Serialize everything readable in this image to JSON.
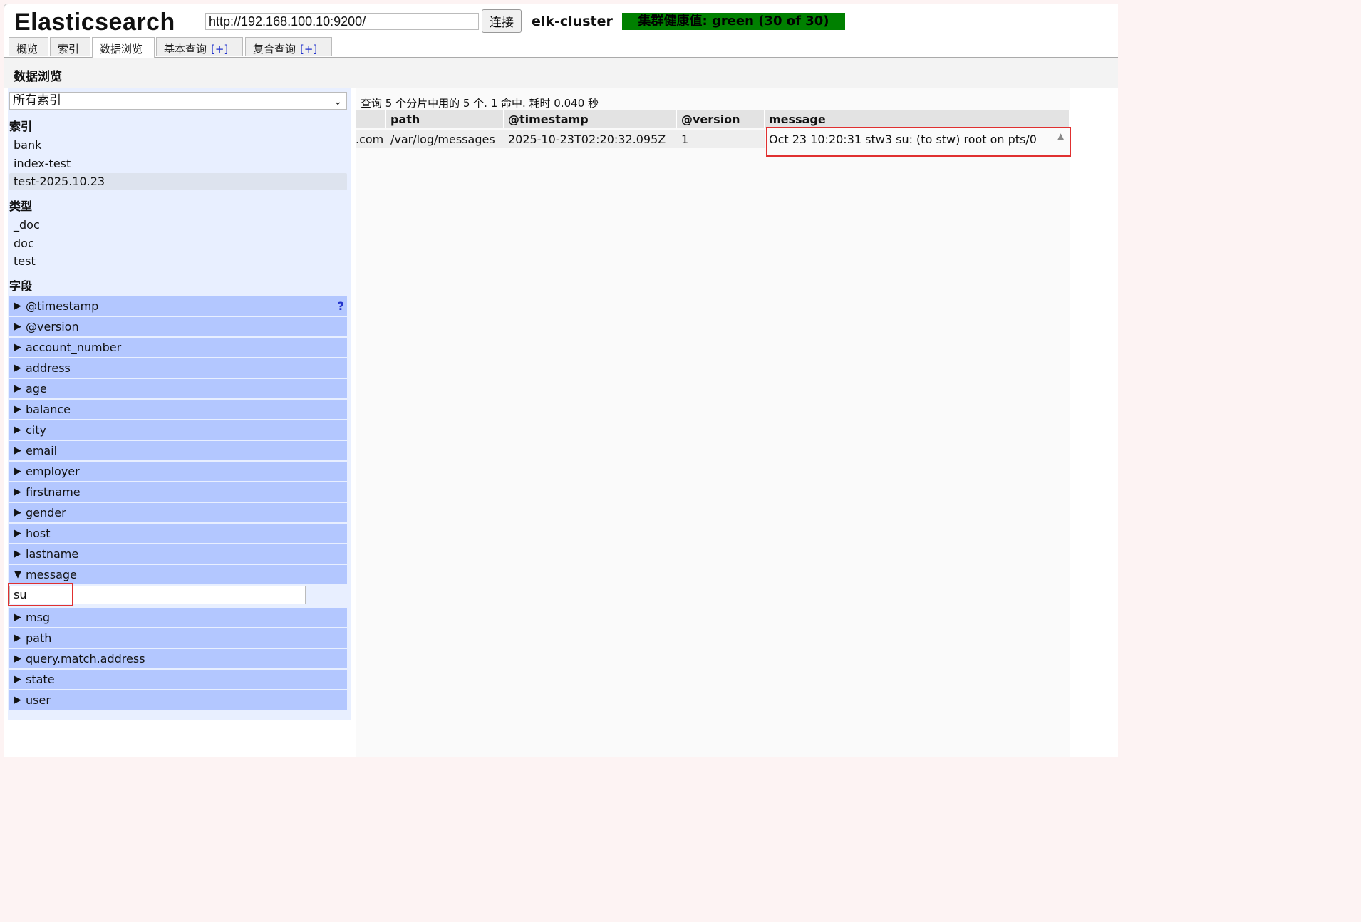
{
  "header": {
    "app_title": "Elasticsearch",
    "url": "http://192.168.100.10:9200/",
    "connect_label": "连接",
    "cluster_name": "elk-cluster",
    "health": "集群健康值: green (30 of 30)",
    "health_color": "#008000"
  },
  "tabs": [
    {
      "label": "概览"
    },
    {
      "label": "索引"
    },
    {
      "label": "数据浏览"
    },
    {
      "label": "基本查询",
      "plus": "[+]"
    },
    {
      "label": "复合查询",
      "plus": "[+]"
    }
  ],
  "section_title": "数据浏览",
  "sidebar": {
    "index_select": "所有索引",
    "indices_heading": "索引",
    "indices": [
      "bank",
      "index-test",
      "test-2025.10.23"
    ],
    "types_heading": "类型",
    "types": [
      "_doc",
      "doc",
      "test"
    ],
    "fields_heading": "字段",
    "fields_before": [
      "@timestamp",
      "@version",
      "account_number",
      "address",
      "age",
      "balance",
      "city",
      "email",
      "employer",
      "firstname",
      "gender",
      "host",
      "lastname"
    ],
    "expanded_field": "message",
    "filter_value": "su",
    "fields_after": [
      "msg",
      "path",
      "query.match.address",
      "state",
      "user"
    ],
    "help_mark": "?"
  },
  "results": {
    "summary": "查询 5 个分片中用的 5 个. 1 命中. 耗时 0.040 秒",
    "columns": [
      "",
      "path",
      "@timestamp",
      "@version",
      "message"
    ],
    "row": [
      ".com",
      "/var/log/messages",
      "2025-10-23T02:20:32.095Z",
      "1",
      "Oct 23 10:20:31 stw3 su: (to stw) root on pts/0"
    ]
  }
}
